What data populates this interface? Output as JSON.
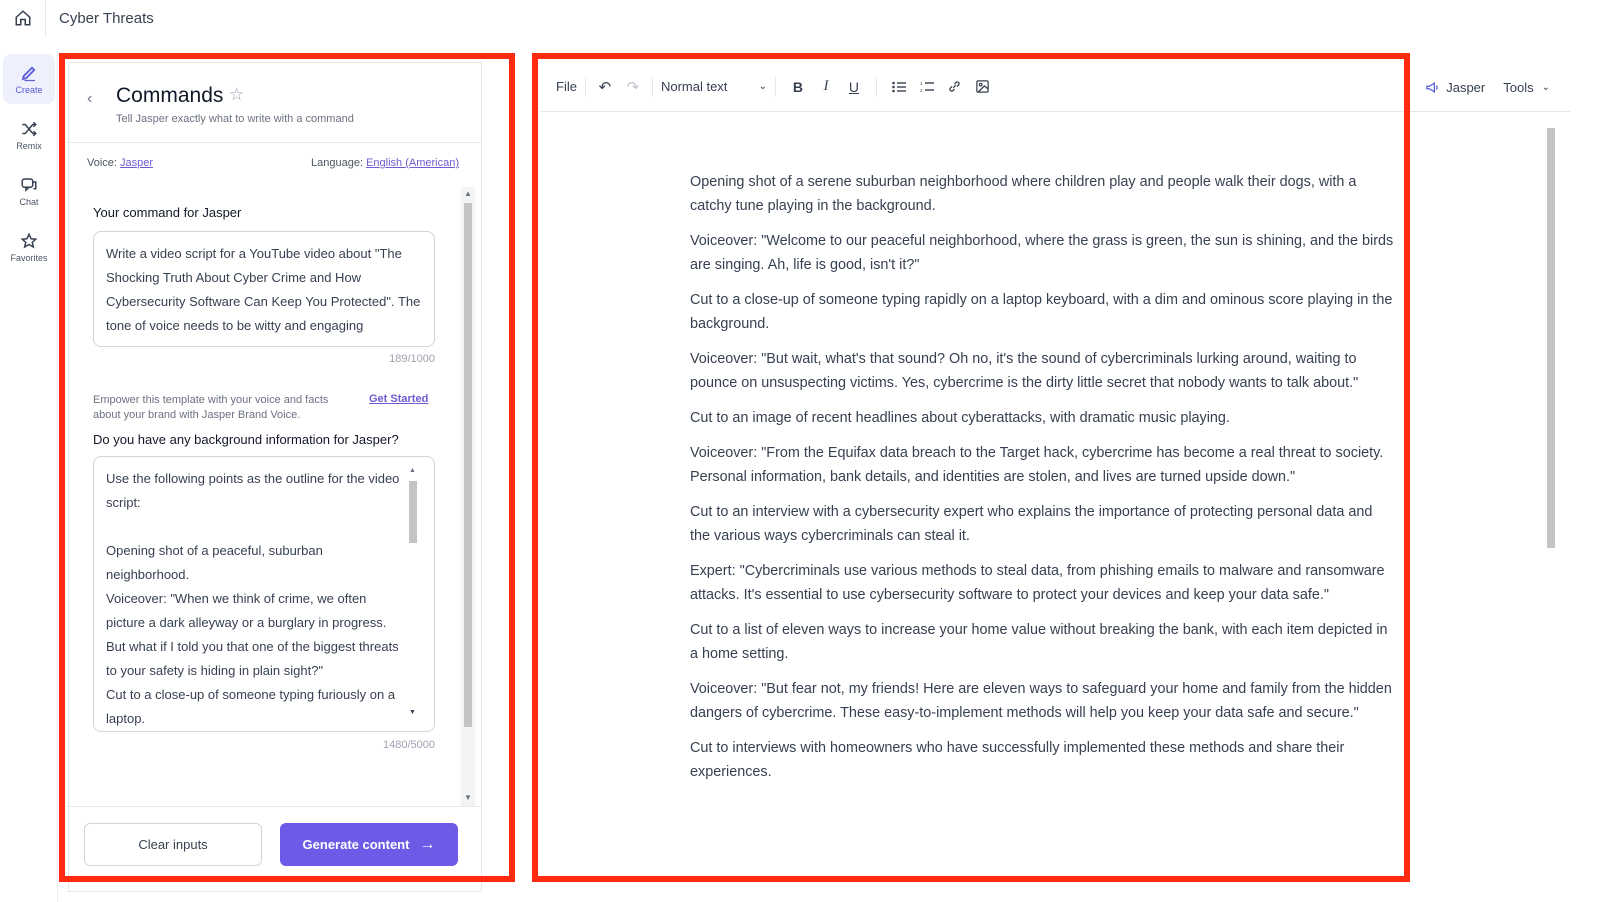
{
  "header": {
    "doc_title": "Cyber Threats"
  },
  "rail": {
    "items": [
      {
        "label": "Create",
        "icon": "pen-icon"
      },
      {
        "label": "Remix",
        "icon": "shuffle-icon"
      },
      {
        "label": "Chat",
        "icon": "chat-icon"
      },
      {
        "label": "Favorites",
        "icon": "star-icon"
      }
    ]
  },
  "panel": {
    "title": "Commands",
    "subtitle": "Tell Jasper exactly what to write with a command",
    "voice_label": "Voice:",
    "voice_value": "Jasper",
    "language_label": "Language:",
    "language_value": "English (American)",
    "command_label": "Your command for Jasper",
    "command_value": "Write a video script for a YouTube video about \"The Shocking Truth About Cyber Crime and How Cybersecurity Software Can Keep You Protected\". The tone of voice needs to be witty and engaging",
    "command_count": "189/1000",
    "brand_note": "Empower this template with your voice and facts about your brand with Jasper Brand Voice.",
    "get_started": "Get Started",
    "background_label": "Do you have any background information for Jasper?",
    "background_value": "Use the following points as the outline for the video script:\n\nOpening shot of a peaceful, suburban neighborhood.\nVoiceover: \"When we think of crime, we often picture a dark alleyway or a burglary in progress. But what if I told you that one of the biggest threats to your safety is hiding in plain sight?\"\nCut to a close-up of someone typing furiously on a laptop.",
    "background_count": "1480/5000",
    "clear_button": "Clear inputs",
    "generate_button": "Generate content"
  },
  "toolbar": {
    "file": "File",
    "text_style": "Normal text",
    "jasper": "Jasper",
    "tools": "Tools"
  },
  "document": {
    "paragraphs": [
      "Opening shot of a serene suburban neighborhood where children play and people walk their dogs, with a catchy tune playing in the background.",
      "Voiceover: \"Welcome to our peaceful neighborhood, where the grass is green, the sun is shining, and the birds are singing. Ah, life is good, isn't it?\"",
      "Cut to a close-up of someone typing rapidly on a laptop keyboard, with a dim and ominous score playing in the background.",
      "Voiceover: \"But wait, what's that sound? Oh no, it's the sound of cybercriminals lurking around, waiting to pounce on unsuspecting victims. Yes, cybercrime is the dirty little secret that nobody wants to talk about.\"",
      "Cut to an image of recent headlines about cyberattacks, with dramatic music playing.",
      "Voiceover: \"From the Equifax data breach to the Target hack, cybercrime has become a real threat to society. Personal information, bank details, and identities are stolen, and lives are turned upside down.\"",
      "Cut to an interview with a cybersecurity expert who explains the importance of protecting personal data and the various ways cybercriminals can steal it.",
      "Expert: \"Cybercriminals use various methods to steal data, from phishing emails to malware and ransomware attacks. It's essential to use cybersecurity software to protect your devices and keep your data safe.\"",
      "Cut to a list of eleven ways to increase your home value without breaking the bank, with each item depicted in a home setting.",
      "Voiceover: \"But fear not, my friends! Here are eleven ways to safeguard your home and family from the hidden dangers of cybercrime. These easy-to-implement methods will help you keep your data safe and secure.\"",
      "Cut to interviews with homeowners who have successfully implemented these methods and share their experiences."
    ]
  },
  "colors": {
    "accent": "#6b5be6",
    "highlight_frame": "#ff2a10"
  }
}
